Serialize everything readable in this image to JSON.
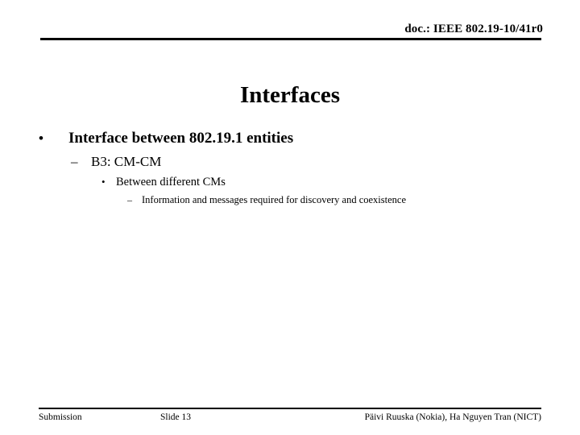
{
  "header": {
    "doc_id": "doc.: IEEE 802.19-10/41r0"
  },
  "title": "Interfaces",
  "outline": [
    {
      "level": 1,
      "marker": "•",
      "text": "Interface between 802.19.1 entities"
    },
    {
      "level": 2,
      "marker": "–",
      "text": "B3: CM-CM"
    },
    {
      "level": 3,
      "marker": "•",
      "text": "Between different CMs"
    },
    {
      "level": 4,
      "marker": "–",
      "text": "Information and messages required for discovery and coexistence"
    }
  ],
  "footer": {
    "left": "Submission",
    "center": "Slide 13",
    "right": "Päivi Ruuska (Nokia), Ha Nguyen Tran (NICT)"
  },
  "colors": {
    "text": "#000000",
    "background": "#ffffff",
    "rule": "#000000"
  }
}
